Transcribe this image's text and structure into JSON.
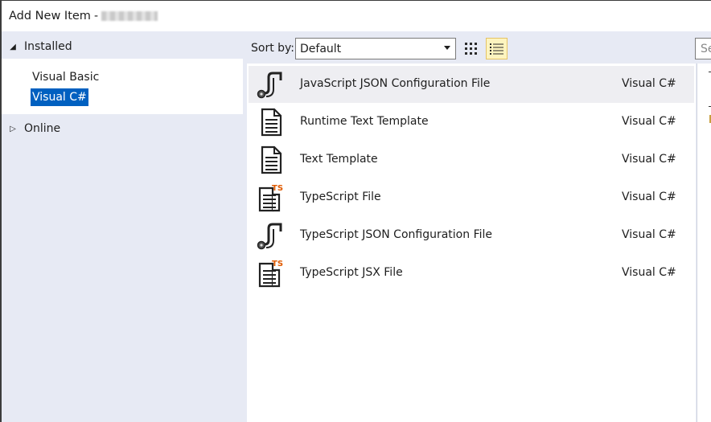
{
  "window": {
    "title": "Add New Item",
    "title_separator": "-"
  },
  "tree": {
    "installed": {
      "label": "Installed",
      "expanded": true
    },
    "children": [
      {
        "label": "Visual Basic",
        "selected": false
      },
      {
        "label": "Visual C#",
        "selected": true
      }
    ],
    "online": {
      "label": "Online",
      "expanded": false
    }
  },
  "toolbar": {
    "sort_label": "Sort by:",
    "sort_value": "Default",
    "view_mode": "list"
  },
  "search": {
    "placeholder": "Se"
  },
  "items": [
    {
      "name": "JavaScript JSON Configuration File",
      "language": "Visual C#",
      "icon": "json-config-icon",
      "selected": true
    },
    {
      "name": "Runtime Text Template",
      "language": "Visual C#",
      "icon": "text-template-icon",
      "selected": false
    },
    {
      "name": "Text Template",
      "language": "Visual C#",
      "icon": "text-template-icon",
      "selected": false
    },
    {
      "name": "TypeScript File",
      "language": "Visual C#",
      "icon": "typescript-file-icon",
      "selected": false
    },
    {
      "name": "TypeScript JSON Configuration File",
      "language": "Visual C#",
      "icon": "json-config-icon",
      "selected": false
    },
    {
      "name": "TypeScript JSX File",
      "language": "Visual C#",
      "icon": "typescript-file-icon",
      "selected": false
    }
  ],
  "colors": {
    "selection": "#0060c0",
    "item_selected_bg": "#eeeef2",
    "panel_bg": "#e7eaf4",
    "ts_badge": "#e05a00"
  }
}
